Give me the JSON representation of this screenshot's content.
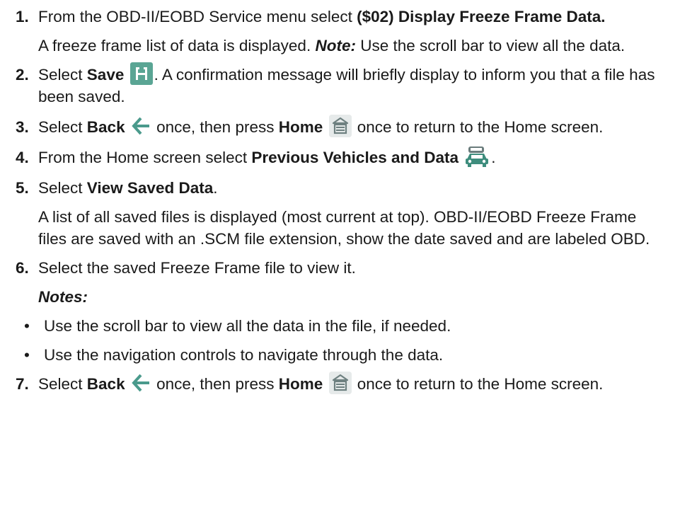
{
  "steps": [
    {
      "num": "1.",
      "pre": "From the OBD-II/EOBD Service menu select ",
      "bold": "($02) Display Freeze Frame Data."
    },
    {
      "num": "2.",
      "pre": "Select ",
      "bold": "Save",
      "post": ". A confirmation message will briefly display to inform you that a file has been saved."
    },
    {
      "num": "3.",
      "pre": "Select ",
      "bold": "Back",
      "mid": " once, then press ",
      "bold2": "Home",
      "post": " once to return to the Home screen."
    },
    {
      "num": "4.",
      "pre": "From the Home screen select ",
      "bold": "Previous Vehicles and Data",
      "post": "."
    },
    {
      "num": "5.",
      "pre": "Select ",
      "bold": "View Saved Data",
      "post": "."
    },
    {
      "num": "6.",
      "pre": "Select the saved Freeze Frame file to view it."
    },
    {
      "num": "7.",
      "pre": "Select ",
      "bold": "Back",
      "mid": " once, then press ",
      "bold2": "Home",
      "post": " once to return to the Home screen."
    }
  ],
  "para1": {
    "pre": "A freeze frame list of data is displayed. ",
    "note": "Note:",
    "post": " Use the scroll bar to view all the data."
  },
  "para5": "A list of all saved files is displayed (most current at top). OBD-II/EOBD Freeze Frame files are saved with an .SCM file extension, show the date saved and are labeled OBD.",
  "notes_label": "Notes:",
  "bullets": [
    "Use the scroll bar to view all the data in the file, if needed.",
    "Use the navigation controls to navigate through the data."
  ],
  "bullet_symbol": "•",
  "icons": {
    "save": "save-icon",
    "back": "back-arrow-icon",
    "home": "home-icon",
    "previous": "previous-vehicles-icon"
  },
  "colors": {
    "text": "#1a1a1a",
    "icon_green": "#4a9a8c",
    "icon_gray": "#7a8a8a"
  }
}
